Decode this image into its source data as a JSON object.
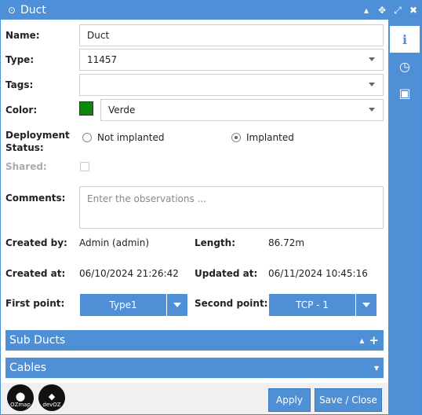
{
  "window": {
    "title": "Duct",
    "title_icon": "target-icon",
    "controls": [
      "collapse-icon",
      "move-icon",
      "expand-icon",
      "close-icon"
    ]
  },
  "sidebar": {
    "tabs": [
      {
        "icon": "info-icon",
        "glyph": "ℹ",
        "active": true
      },
      {
        "icon": "clock-icon",
        "glyph": "◷",
        "active": false
      },
      {
        "icon": "image-icon",
        "glyph": "▣",
        "active": false
      }
    ]
  },
  "form": {
    "name_label": "Name:",
    "name_value": "Duct",
    "type_label": "Type:",
    "type_value": "11457",
    "tags_label": "Tags:",
    "tags_value": "",
    "color_label": "Color:",
    "color_value": "Verde",
    "color_swatch": "#0a8a0a",
    "deployment_label_line1": "Deployment",
    "deployment_label_line2": "Status:",
    "deployment_options": [
      {
        "label": "Not implanted",
        "checked": false
      },
      {
        "label": "Implanted",
        "checked": true
      }
    ],
    "shared_label": "Shared:",
    "shared_checked": false,
    "comments_label": "Comments:",
    "comments_placeholder": "Enter the observations ..."
  },
  "info": {
    "created_by_label": "Created by:",
    "created_by_value": "Admin (admin)",
    "length_label": "Length:",
    "length_value": "86.72m",
    "created_at_label": "Created at:",
    "created_at_value": "06/10/2024 21:26:42",
    "updated_at_label": "Updated at:",
    "updated_at_value": "06/11/2024 10:45:16",
    "first_point_label": "First point:",
    "first_point_value": "Type1",
    "second_point_label": "Second point:",
    "second_point_value": "TCP - 1"
  },
  "sections": {
    "sub_ducts": "Sub Ducts",
    "cables": "Cables"
  },
  "footer": {
    "logo1_text": "OZmap",
    "logo2_text": "devOZ",
    "apply_label": "Apply",
    "save_close_label": "Save / Close"
  },
  "colors": {
    "accent": "#4f8fd6"
  }
}
